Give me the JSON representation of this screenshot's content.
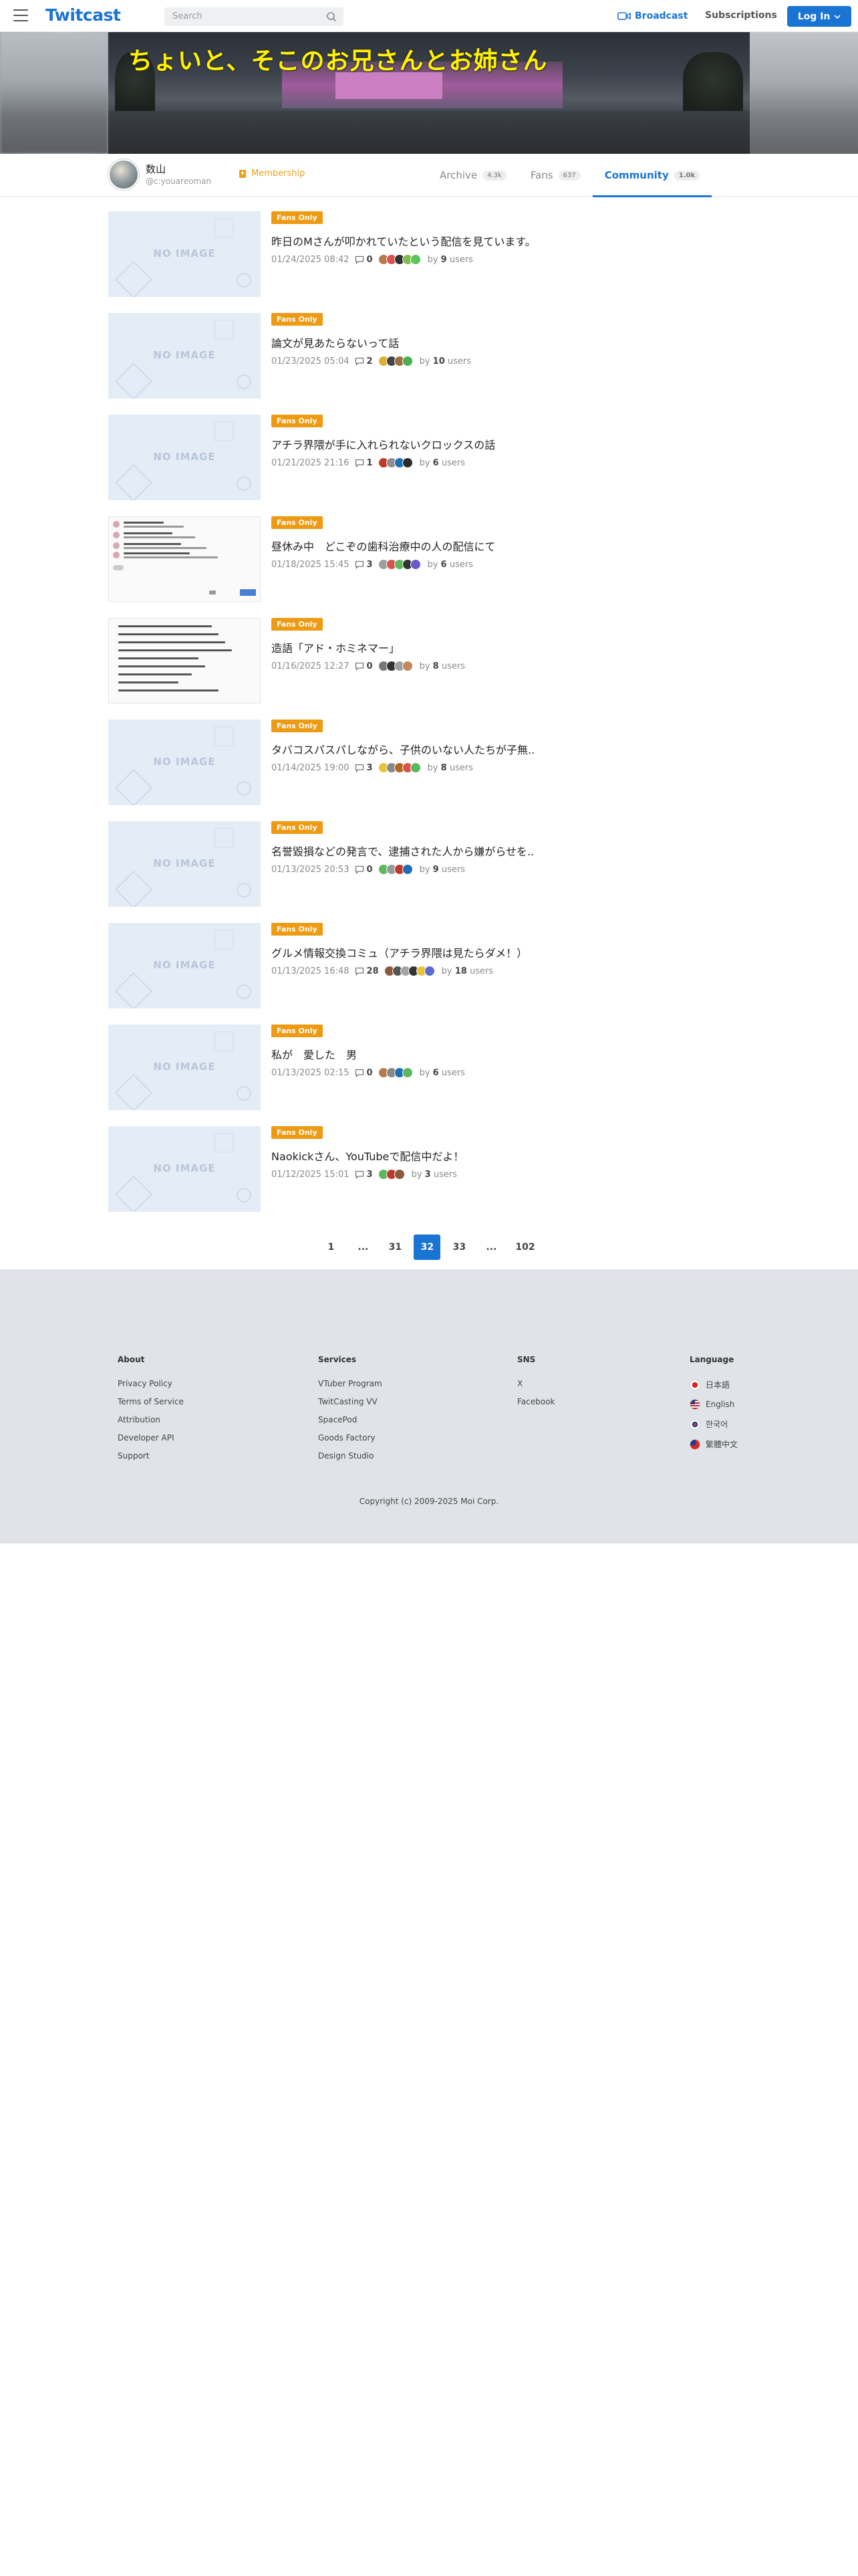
{
  "header": {
    "logo": "Twitcast",
    "search_placeholder": "Search",
    "broadcast": "Broadcast",
    "subscriptions": "Subscriptions",
    "login": "Log In"
  },
  "banner": {
    "title": "ちょいと、そこのお兄さんとお姉さん"
  },
  "profile": {
    "name": "数山",
    "handle": "@c:youareoman",
    "membership": "Membership"
  },
  "tabs": [
    {
      "label": "Archive",
      "count": "4.3k"
    },
    {
      "label": "Fans",
      "count": "637"
    },
    {
      "label": "Community",
      "count": "1.0k"
    }
  ],
  "posts": [
    {
      "badge": "Fans Only",
      "title": "昨日のMさんが叩かれていたという配信を見ています。",
      "date": "01/24/2025 08:42",
      "comments": "0",
      "users": "9",
      "thumb": "none",
      "avatars": [
        "#b87a4b",
        "#d9534f",
        "#333333",
        "#7fbf4d",
        "#5bc45b"
      ]
    },
    {
      "badge": "Fans Only",
      "title": "論文が見あたらないって話",
      "date": "01/23/2025 05:04",
      "comments": "2",
      "users": "10",
      "thumb": "none",
      "avatars": [
        "#e0b030",
        "#444444",
        "#9a6f3e",
        "#4caf50"
      ]
    },
    {
      "badge": "Fans Only",
      "title": "アチラ界隈が手に入れられないクロックスの話",
      "date": "01/21/2025 21:16",
      "comments": "1",
      "users": "6",
      "thumb": "none",
      "avatars": [
        "#c0392b",
        "#8e8e8e",
        "#1f6fb2",
        "#2c2c2c"
      ]
    },
    {
      "badge": "Fans Only",
      "title": "昼休み中　どこぞの歯科治療中の人の配信にて",
      "date": "01/18/2025 15:45",
      "comments": "3",
      "users": "6",
      "thumb": "shot",
      "avatars": [
        "#9e9e9e",
        "#d9534f",
        "#5cb85c",
        "#333333",
        "#6a5acd"
      ]
    },
    {
      "badge": "Fans Only",
      "title": "造語「アド・ホミネマー」",
      "date": "01/16/2025 12:27",
      "comments": "0",
      "users": "8",
      "thumb": "shot2",
      "avatars": [
        "#777777",
        "#333333",
        "#a0a0a0",
        "#c28a5a"
      ]
    },
    {
      "badge": "Fans Only",
      "title": "タバコスパスパしながら、子供のいない人たちが子無..",
      "date": "01/14/2025 19:00",
      "comments": "3",
      "users": "8",
      "thumb": "none",
      "avatars": [
        "#e8c33a",
        "#888888",
        "#b5651d",
        "#d9534f",
        "#5cb85c"
      ]
    },
    {
      "badge": "Fans Only",
      "title": "名誉毀損などの発言で、逮捕された人から嫌がらせを..",
      "date": "01/13/2025 20:53",
      "comments": "0",
      "users": "9",
      "thumb": "none",
      "avatars": [
        "#5cb85c",
        "#999999",
        "#c0392b",
        "#1f6fb2"
      ]
    },
    {
      "badge": "Fans Only",
      "title": "グルメ情報交換コミュ（アチラ界隈は見たらダメ！）",
      "date": "01/13/2025 16:48",
      "comments": "28",
      "users": "18",
      "thumb": "none",
      "avatars": [
        "#8a5a3c",
        "#555555",
        "#a5a5a5",
        "#333333",
        "#e8c33a",
        "#5a6ad0"
      ]
    },
    {
      "badge": "Fans Only",
      "title": "私が　愛した　男",
      "date": "01/13/2025 02:15",
      "comments": "0",
      "users": "6",
      "thumb": "none",
      "avatars": [
        "#b87a4b",
        "#888888",
        "#1f6fb2",
        "#5cb85c"
      ]
    },
    {
      "badge": "Fans Only",
      "title": "Naokickさん、YouTubeで配信中だよ！",
      "date": "01/12/2025 15:01",
      "comments": "3",
      "users": "3",
      "thumb": "none",
      "avatars": [
        "#5cb85c",
        "#c0392b",
        "#8a5a3c"
      ]
    }
  ],
  "post_labels": {
    "noimage": "NO IMAGE",
    "by": "by",
    "users": "users"
  },
  "pagination": [
    "1",
    "...",
    "31",
    "32",
    "33",
    "...",
    "102"
  ],
  "pagination_active": "32",
  "footer": {
    "about": {
      "heading": "About",
      "items": [
        "Privacy Policy",
        "Terms of Service",
        "Attribution",
        "Developer API",
        "Support"
      ]
    },
    "services": {
      "heading": "Services",
      "items": [
        "VTuber Program",
        "TwitCasting VV",
        "SpacePod",
        "Goods Factory",
        "Design Studio"
      ]
    },
    "sns": {
      "heading": "SNS",
      "items": [
        "X",
        "Facebook"
      ]
    },
    "language": {
      "heading": "Language",
      "items": [
        "日本語",
        "English",
        "한국어",
        "繁體中文"
      ]
    },
    "copyright": "Copyright (c) 2009-2025 Moi Corp."
  },
  "colors": {
    "accent": "#1a74d4",
    "badge": "#ee9a12",
    "membership": "#e6a21a"
  }
}
